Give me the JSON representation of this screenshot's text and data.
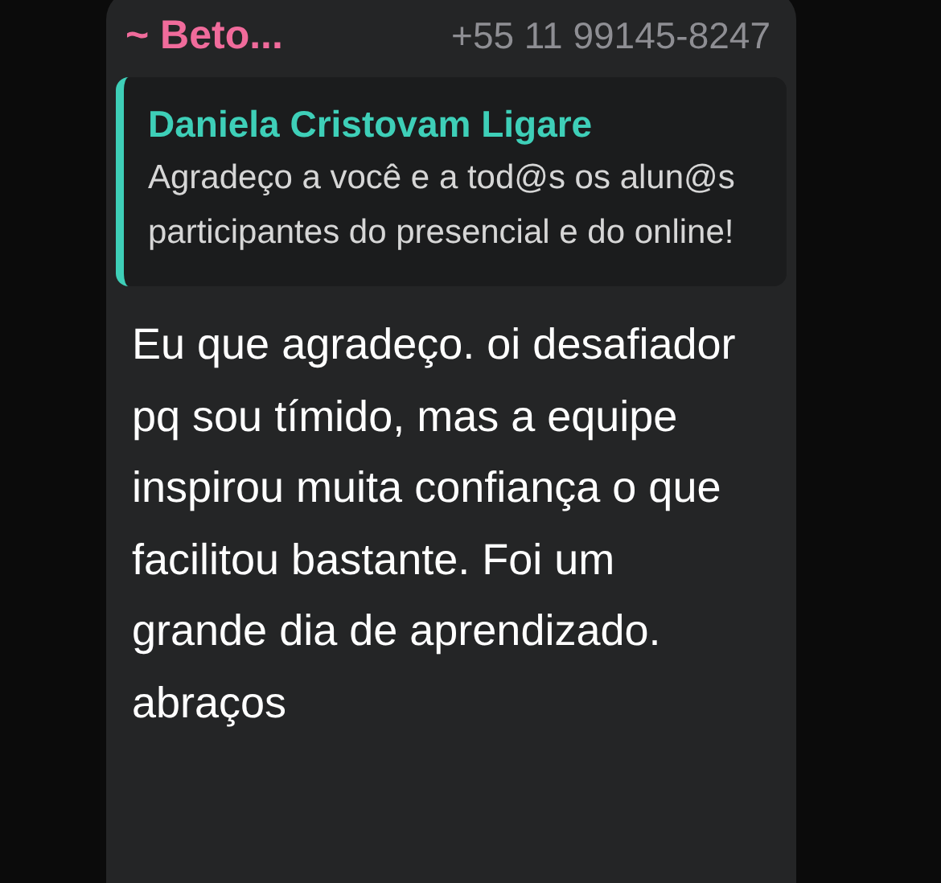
{
  "message": {
    "sender": "~ Beto...",
    "phone": "+55 11 99145-8247",
    "quote": {
      "author": "Daniela Cristovam Ligare",
      "text": "Agradeço a você e a tod@s os alun@s participantes do presencial e do online!"
    },
    "text": "Eu que agradeço. oi desafiador pq sou tímido, mas a equipe inspirou muita confiança o que facilitou bastante. Foi um grande dia de aprendizado. abraços"
  }
}
